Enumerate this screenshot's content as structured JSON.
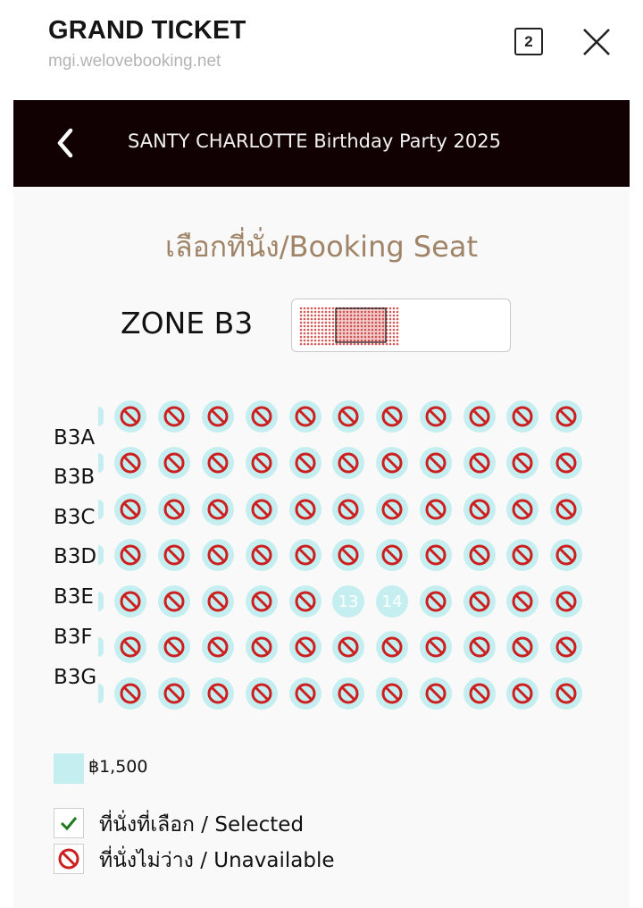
{
  "app": {
    "title": "GRAND TICKET",
    "url": "mgi.welovebooking.net",
    "tab_count": "2"
  },
  "header": {
    "event_title": "SANTY CHARLOTTE Birthday Party 2025"
  },
  "page": {
    "title": "เลือกที่นั่ง/Booking Seat",
    "zone_label": "ZONE B3"
  },
  "seatmap": {
    "rows": [
      "B3A",
      "B3B",
      "B3C",
      "B3D",
      "B3E",
      "B3F",
      "B3G"
    ],
    "available_seats": [
      {
        "row": "B3E",
        "number": "13"
      },
      {
        "row": "B3E",
        "number": "14"
      }
    ],
    "seat_color": "#c5eef0",
    "unavailable_icon_color": "#cc1f1f"
  },
  "legend": {
    "price": "฿1,500",
    "selected": "ที่นั่งที่เลือก / Selected",
    "unavailable": "ที่นั่งไม่ว่าง / Unavailable"
  },
  "icons": {
    "back": "chevron-left-icon",
    "close": "close-icon",
    "unavailable": "no-entry-icon",
    "selected": "check-icon"
  }
}
